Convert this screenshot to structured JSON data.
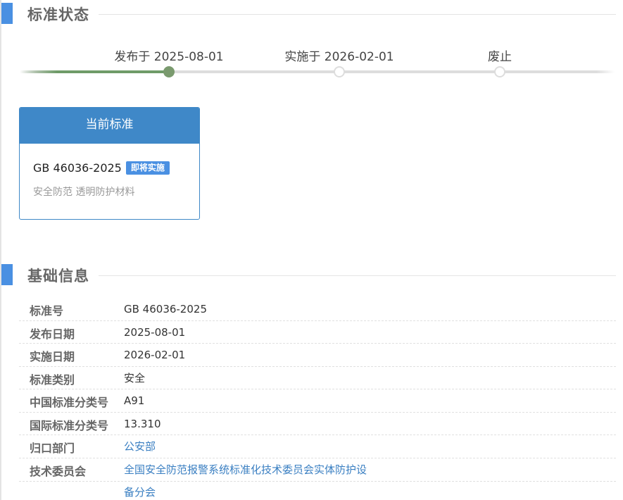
{
  "status_section": {
    "title": "标准状态"
  },
  "timeline": {
    "steps": [
      {
        "label": "发布于 2025-08-01",
        "state": "done"
      },
      {
        "label": "实施于 2026-02-01",
        "state": "pending"
      },
      {
        "label": "废止",
        "state": "pending"
      }
    ]
  },
  "current_card": {
    "header": "当前标准",
    "code": "GB 46036-2025",
    "badge": "即将实施",
    "name": "安全防范 透明防护材料"
  },
  "basic_section": {
    "title": "基础信息"
  },
  "info_rows": [
    {
      "key": "标准号",
      "value": "GB 46036-2025",
      "link": false
    },
    {
      "key": "发布日期",
      "value": "2025-08-01",
      "link": false
    },
    {
      "key": "实施日期",
      "value": "2026-02-01",
      "link": false
    },
    {
      "key": "标准类别",
      "value": "安全",
      "link": false
    },
    {
      "key": "中国标准分类号",
      "value": "A91",
      "link": false
    },
    {
      "key": "国际标准分类号",
      "value": "13.310",
      "link": false
    },
    {
      "key": "归口部门",
      "value": "公安部",
      "link": true
    },
    {
      "key": "技术委员会",
      "value": "全国安全防范报警系统标准化技术委员会实体防护设备分会",
      "link": true
    }
  ],
  "colors": {
    "accent": "#4a90e2",
    "card_header": "#3f88c8",
    "timeline_done": "#7a9a6e",
    "link": "#3a7fc2"
  }
}
